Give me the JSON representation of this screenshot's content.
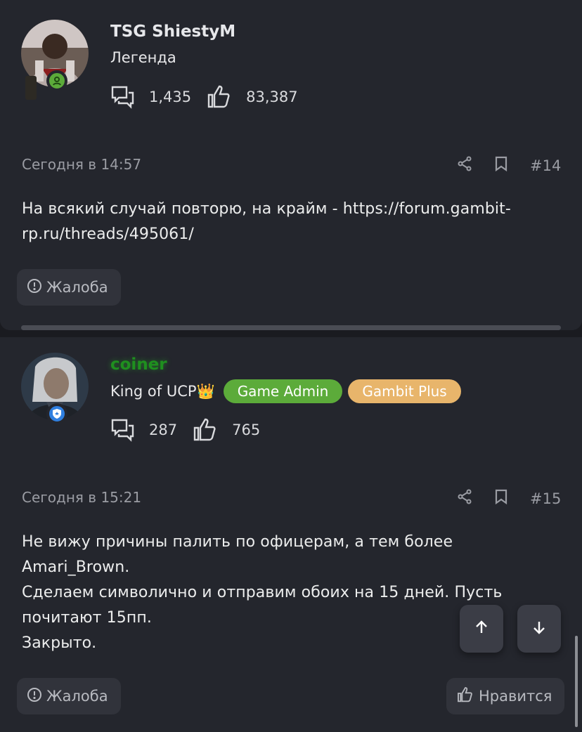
{
  "posts": [
    {
      "author": "TSG ShiestyM",
      "author_color": "#e6e7ea",
      "title": "Легенда",
      "messages_count": "1,435",
      "reactions_count": "83,387",
      "date": "Сегодня в 14:57",
      "number": "#14",
      "text_lines": [
        "На всякий случай повторю, на крайм - https://forum.gambit-",
        "rp.ru/threads/495061/"
      ],
      "report_label": "Жалоба"
    },
    {
      "author": "coiner",
      "author_color": "#1f8f1f",
      "title": "King of UCP👑",
      "badges": [
        {
          "label": "Game Admin",
          "color": "#5cab3a"
        },
        {
          "label": "Gambit Plus",
          "color": "#e8b56b"
        }
      ],
      "messages_count": "287",
      "reactions_count": "765",
      "date": "Сегодня в 15:21",
      "number": "#15",
      "text_lines": [
        "Не вижу причины палить по офицерам, а тем более",
        "Amari_Brown.",
        "Сделаем символично и отправим обоих на 15 дней. Пусть",
        "почитают 15пп.",
        "Закрыто."
      ],
      "report_label": "Жалоба",
      "like_label": "Нравится"
    }
  ],
  "icons": {
    "messages": "speech-bubbles-icon",
    "reactions": "thumbs-up-icon",
    "share": "share-icon",
    "bookmark": "bookmark-icon",
    "report": "exclamation-circle-icon",
    "scroll_up": "arrow-up-icon",
    "scroll_down": "arrow-down-icon"
  }
}
